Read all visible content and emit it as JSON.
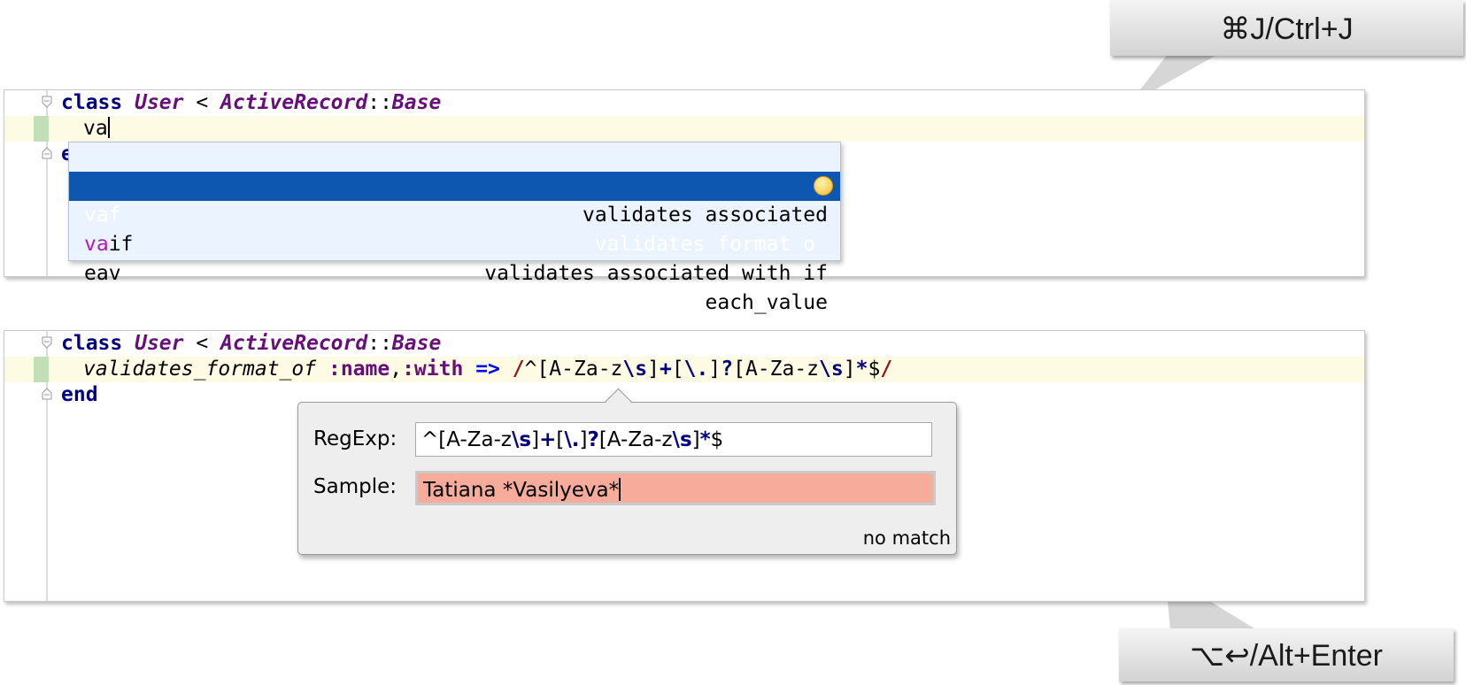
{
  "shortcuts": {
    "top": "⌘J/Ctrl+J",
    "bottom": "⌥↩/Alt+Enter"
  },
  "editor1": {
    "line1": {
      "kw": "class",
      "name": "User",
      "op": " < ",
      "module": "ActiveRecord",
      "sep": "::",
      "base": "Base"
    },
    "line2_typed": "va",
    "line3_partial": "e"
  },
  "completion": {
    "items": [
      {
        "match": "va",
        "rest": "",
        "desc": "validates associated"
      },
      {
        "match": "",
        "rest": "vaf",
        "desc": "validates format o"
      },
      {
        "match": "va",
        "rest": "if",
        "desc": "validates associated with if"
      },
      {
        "match": "",
        "rest": "eav",
        "desc": "each_value"
      }
    ],
    "selected_index": 1
  },
  "editor2": {
    "line1": {
      "kw": "class",
      "name": "User",
      "op": " < ",
      "module": "ActiveRecord",
      "sep": "::",
      "base": "Base"
    },
    "line2": {
      "method": "validates_format_of",
      "sym1": ":name",
      "comma": ",",
      "sym2": ":with",
      "arrow": "=>",
      "regex_open": "/",
      "regex": [
        "^[A-Za-z",
        "\\s",
        "]",
        "+",
        "[",
        "\\.",
        "]",
        "?",
        "[A-Za-z",
        "\\s",
        "]",
        "*",
        "$"
      ],
      "regex_close": "/"
    },
    "line3": "end"
  },
  "regex_check": {
    "regexp_label": "RegExp:",
    "regexp_parts": [
      "^[A-Za-z",
      "\\s",
      "]",
      "+",
      "[",
      "\\.",
      "]",
      "?",
      "[A-Za-z",
      "\\s",
      "]",
      "*",
      "$"
    ],
    "sample_label": "Sample:",
    "sample_value": "Tatiana *Vasilyeva*",
    "result": "no match"
  },
  "colors": {
    "selection": "#0e57b0",
    "popup_bg": "#ebf4fe",
    "no_match_bg": "#f7ab9a",
    "keyword": "#000080",
    "constant": "#660e7a"
  }
}
